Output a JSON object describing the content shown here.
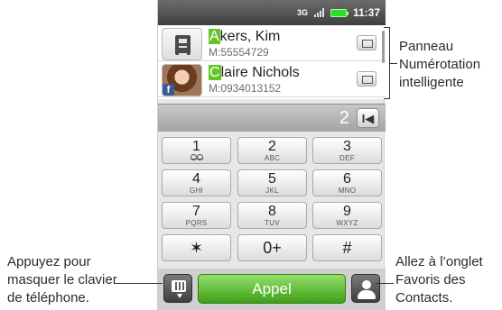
{
  "status_bar": {
    "time": "11:37",
    "network_label": "3G"
  },
  "contacts": [
    {
      "highlight": "A",
      "rest": "kers, Kim",
      "number": "M:55554729",
      "avatar": "sim-card-icon"
    },
    {
      "highlight": "C",
      "rest": "laire Nichols",
      "number": "M:0934013152",
      "avatar": "contact-photo",
      "badge": "f"
    }
  ],
  "input": {
    "typed": "2",
    "backspace": "I◀"
  },
  "keypad": [
    {
      "digit": "1",
      "letters": ""
    },
    {
      "digit": "2",
      "letters": "ABC"
    },
    {
      "digit": "3",
      "letters": "DEF"
    },
    {
      "digit": "4",
      "letters": "GHI"
    },
    {
      "digit": "5",
      "letters": "JKL"
    },
    {
      "digit": "6",
      "letters": "MNO"
    },
    {
      "digit": "7",
      "letters": "PQRS"
    },
    {
      "digit": "8",
      "letters": "TUV"
    },
    {
      "digit": "9",
      "letters": "WXYZ"
    },
    {
      "digit": "✶",
      "letters": ""
    },
    {
      "digit": "0+",
      "letters": ""
    },
    {
      "digit": "#",
      "letters": ""
    }
  ],
  "bottom_bar": {
    "call_label": "Appel"
  },
  "callouts": {
    "panel": [
      "Panneau",
      "Numérotation",
      "intelligente"
    ],
    "keyboard": [
      "Appuyez pour",
      "masquer le clavier",
      "de téléphone."
    ],
    "favorites": [
      "Allez à l’onglet",
      "Favoris des",
      "Contacts."
    ]
  }
}
